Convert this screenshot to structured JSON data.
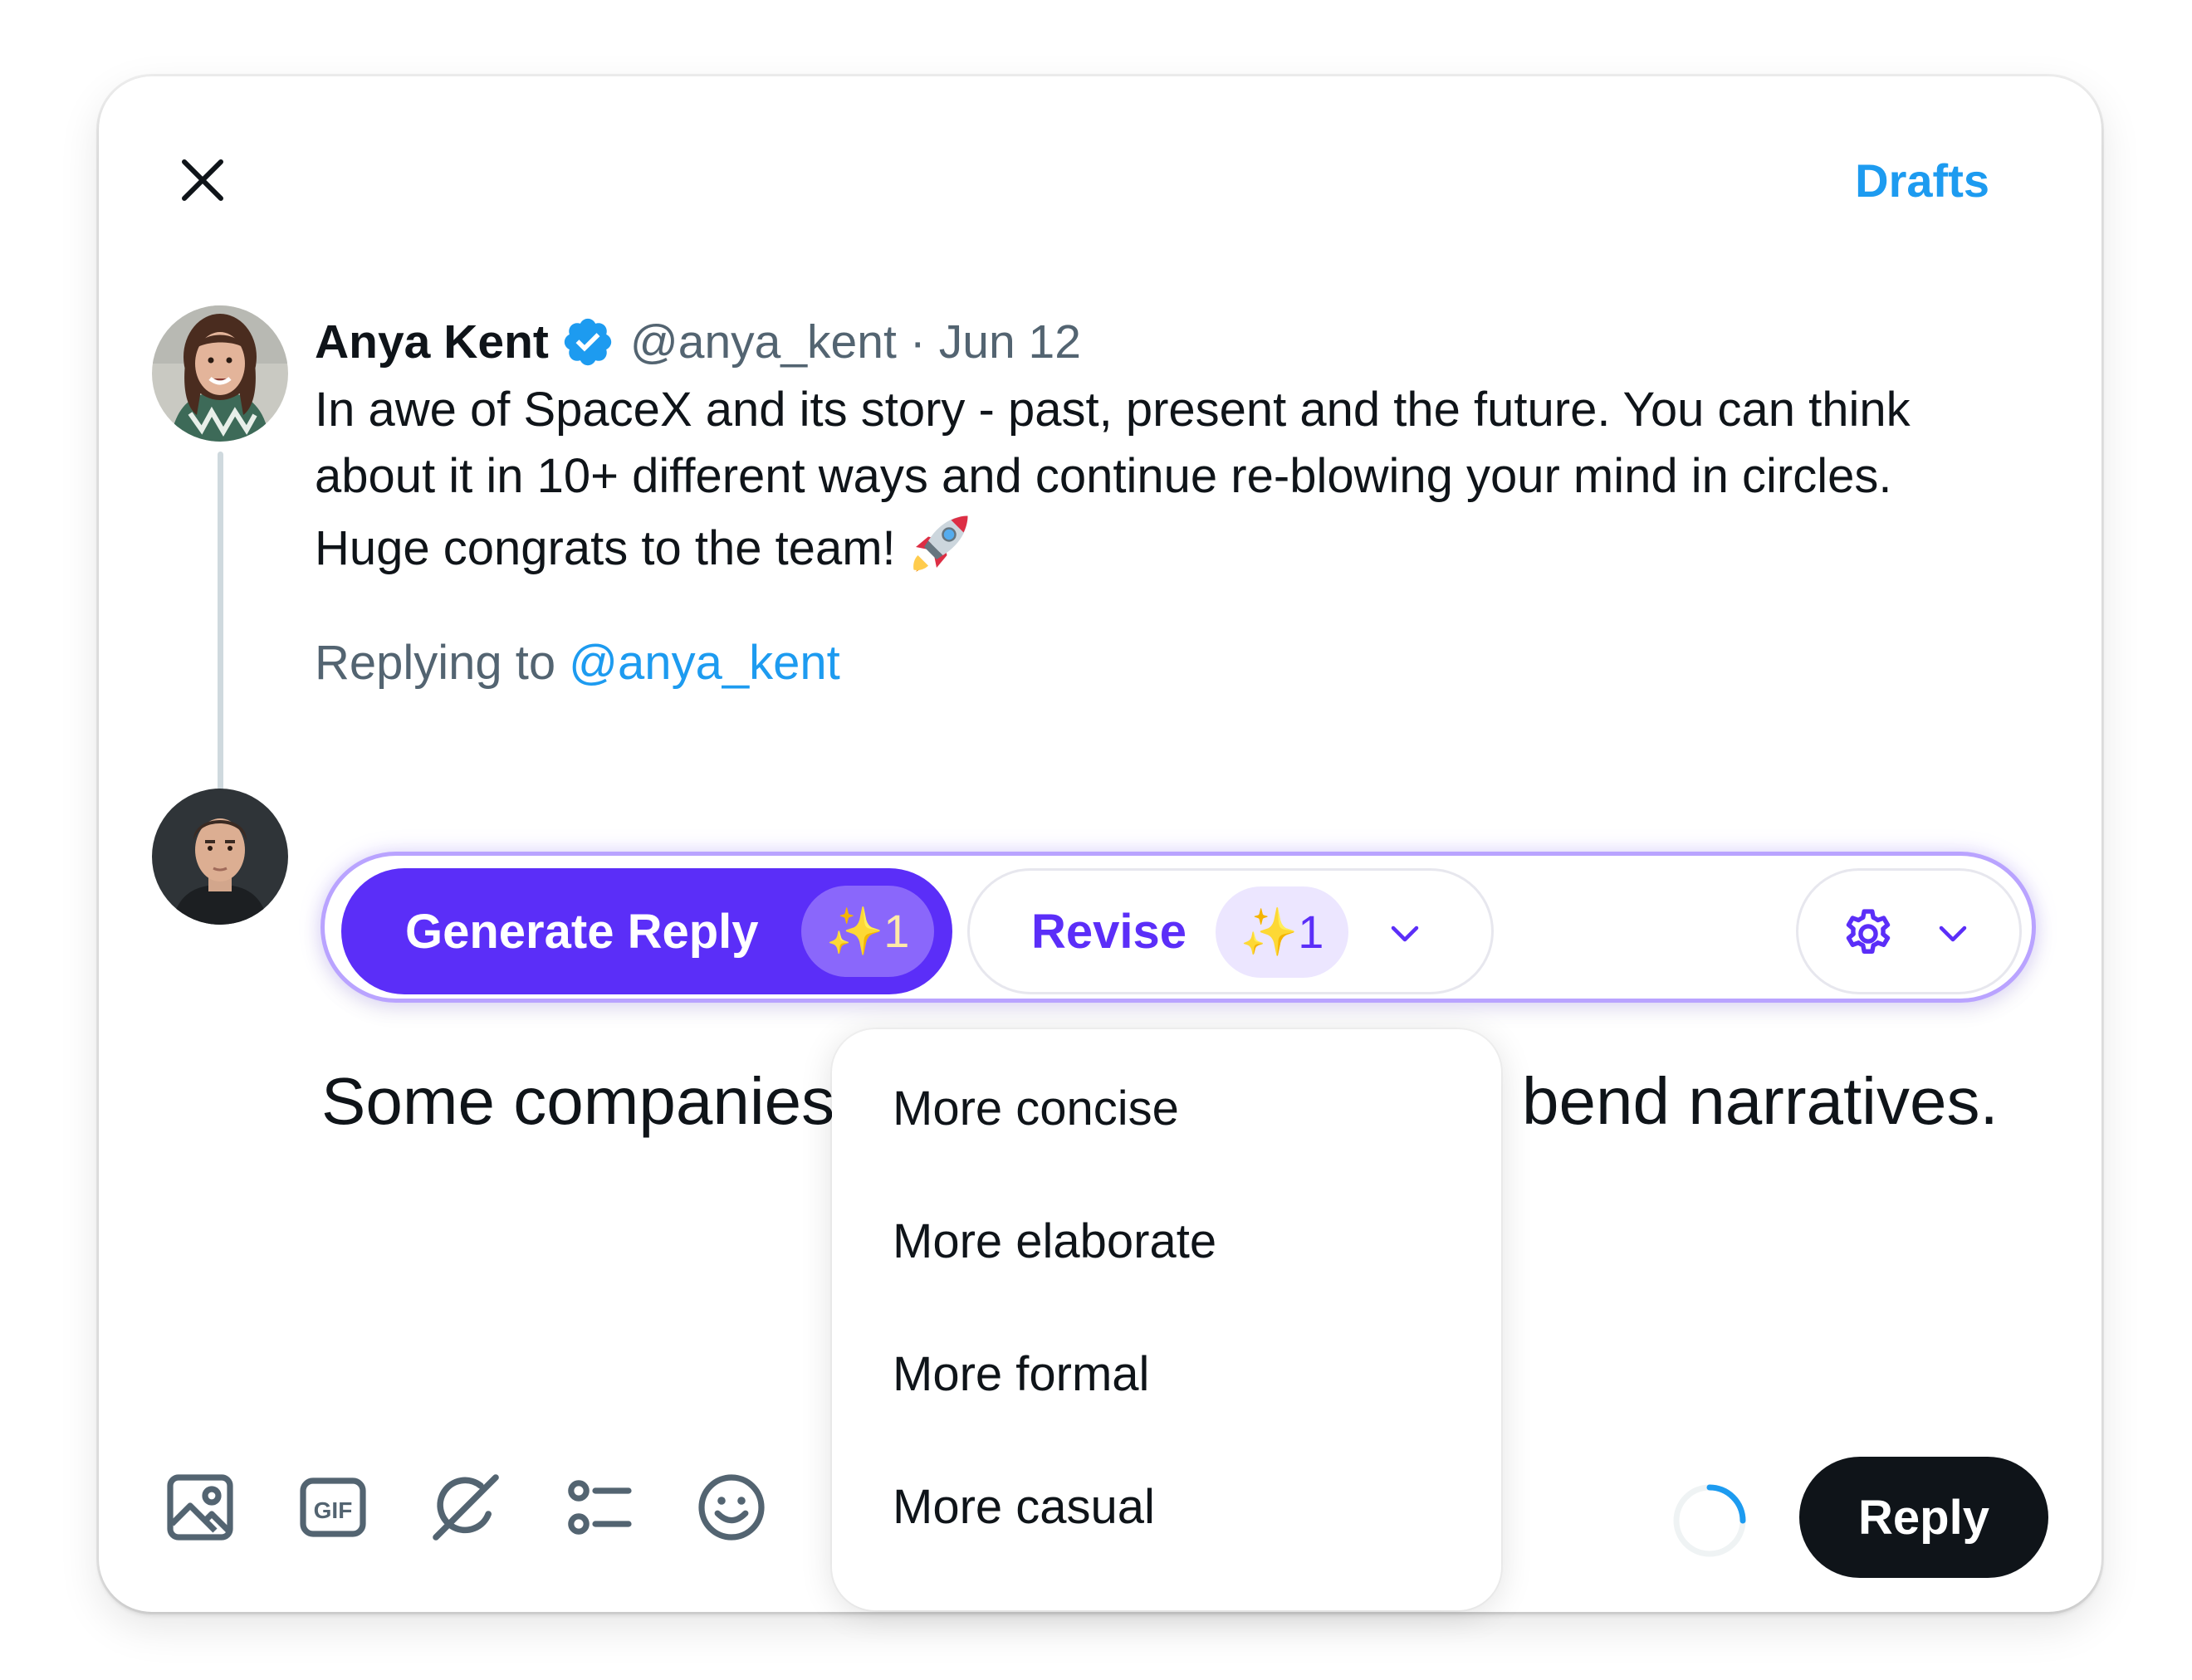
{
  "header": {
    "close_icon": "close-icon",
    "drafts_label": "Drafts"
  },
  "tweet": {
    "author_name": "Anya Kent",
    "handle": "@anya_kent",
    "separator": "·",
    "date": "Jun 12",
    "verified_icon": "verified-badge-icon",
    "lines": [
      "In awe of SpaceX and its story - past, present and the future. You can think",
      "about it in 10+ different ways and continue re-blowing your mind in circles.",
      "Huge congrats to the team!"
    ],
    "emoji_icon": "rocket-emoji",
    "replying_prefix": "Replying to",
    "replying_mention": "@anya_kent"
  },
  "ai_toolbar": {
    "generate_label": "Generate Reply",
    "generate_badge": "✨1",
    "revise_label": "Revise",
    "revise_badge": "✨1",
    "settings_icon": "gear-icon",
    "accent_color": "#5b2ef8",
    "border_color": "#b9a3ff"
  },
  "compose": {
    "text_before": "Some companies",
    "text_after": "bend narratives."
  },
  "revise_menu": {
    "items": [
      "More concise",
      "More elaborate",
      "More formal",
      "More casual"
    ]
  },
  "bottom_toolbar": {
    "icons": [
      "image-icon",
      "gif-icon",
      "grok-icon",
      "poll-icon",
      "emoji-icon"
    ],
    "reply_label": "Reply",
    "link_color": "#1d9bf0"
  }
}
